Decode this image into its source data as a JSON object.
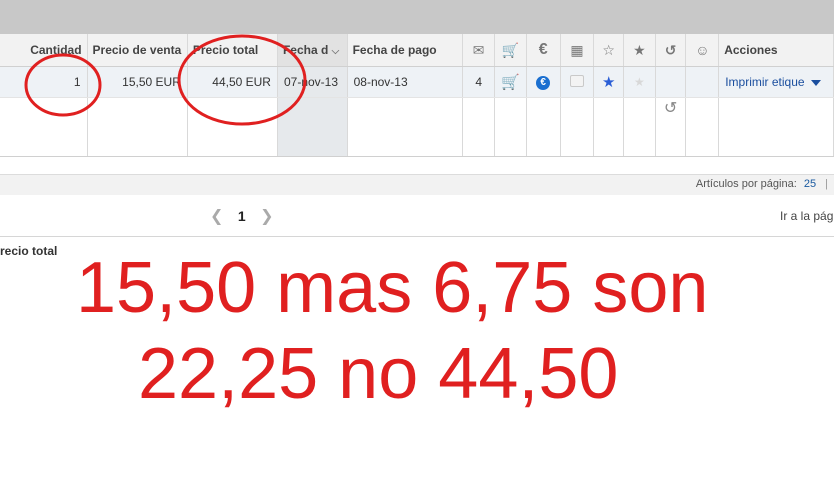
{
  "table": {
    "headers": {
      "cantidad": "Cantidad",
      "precio_venta": "Precio de venta",
      "precio_total": "Precio total",
      "fecha_d": "Fecha d",
      "fecha_pago": "Fecha de pago",
      "acciones": "Acciones"
    },
    "row": {
      "cantidad": "1",
      "precio_venta": "15,50 EUR",
      "precio_total": "44,50 EUR",
      "fecha": "07-nov-13",
      "fecha_pago": "08-nov-13",
      "mensajes": "4",
      "acciones": "Imprimir etique"
    }
  },
  "icons": {
    "mail": "envelope-icon",
    "cart": "cart-icon",
    "euro": "euro-icon",
    "package": "package-icon",
    "star_review": "star-edit-icon",
    "star": "star-icon",
    "undo": "undo-icon",
    "people": "people-icon"
  },
  "colors": {
    "annotation_red": "#e02020",
    "link_blue": "#1a4e9e",
    "price_purple": "#7a3f9a",
    "header_gray": "#c8c8c8"
  },
  "pagination": {
    "per_page_label": "Artículos por página:",
    "per_page_value": "25",
    "separator": "|",
    "current_page": "1",
    "goto_label": "Ir a la pág"
  },
  "footer": {
    "total_label": "recio total"
  },
  "annotation": {
    "line1": "15,50 mas 6,75 son",
    "line2": "22,25 no 44,50"
  }
}
